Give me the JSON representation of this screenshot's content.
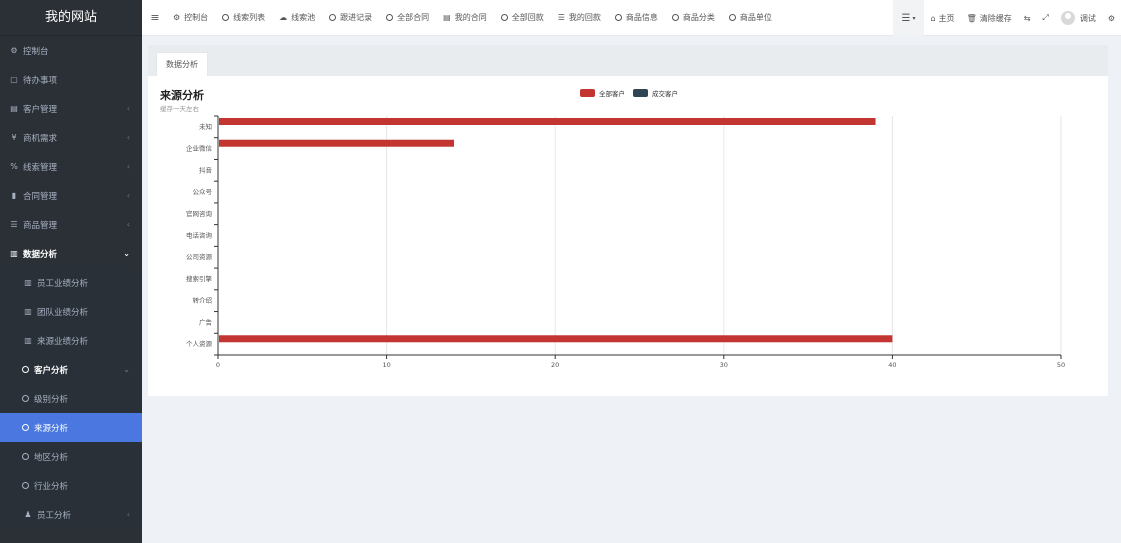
{
  "app": {
    "title": "我的网站"
  },
  "sidebar": {
    "items": [
      {
        "label": "控制台",
        "icon": "dashboard-icon",
        "glyph": "⚙",
        "type": "top"
      },
      {
        "label": "待办事项",
        "icon": "calendar-icon",
        "glyph": "▢",
        "type": "top"
      },
      {
        "label": "客户管理",
        "icon": "id-card-icon",
        "glyph": "▤",
        "type": "top",
        "arrow": "‹"
      },
      {
        "label": "商机需求",
        "icon": "yen-icon",
        "glyph": "¥",
        "type": "top",
        "arrow": "‹"
      },
      {
        "label": "线索管理",
        "icon": "link-icon",
        "glyph": "%",
        "type": "top",
        "arrow": "‹"
      },
      {
        "label": "合同管理",
        "icon": "bookmark-icon",
        "glyph": "▮",
        "type": "top",
        "arrow": "‹"
      },
      {
        "label": "商品管理",
        "icon": "list-icon",
        "glyph": "☰",
        "type": "top",
        "arrow": "‹"
      },
      {
        "label": "数据分析",
        "icon": "bar-chart-icon",
        "glyph": "▥",
        "type": "open",
        "arrow": "⌄"
      },
      {
        "label": "员工业绩分析",
        "icon": "bar-chart-icon",
        "glyph": "▥",
        "type": "sub"
      },
      {
        "label": "团队业绩分析",
        "icon": "bar-chart-icon",
        "glyph": "▥",
        "type": "sub"
      },
      {
        "label": "来源业绩分析",
        "icon": "bar-chart-icon",
        "glyph": "▥",
        "type": "sub"
      },
      {
        "label": "客户分析",
        "icon": "circle-icon",
        "glyph": "",
        "type": "subhead",
        "arrow": "⌄"
      },
      {
        "label": "级别分析",
        "icon": "circle-icon",
        "glyph": "",
        "type": "sub2"
      },
      {
        "label": "来源分析",
        "icon": "circle-icon",
        "glyph": "",
        "type": "active"
      },
      {
        "label": "地区分析",
        "icon": "circle-icon",
        "glyph": "",
        "type": "sub2"
      },
      {
        "label": "行业分析",
        "icon": "circle-icon",
        "glyph": "",
        "type": "sub2"
      },
      {
        "label": "员工分析",
        "icon": "user-icon",
        "glyph": "♟",
        "type": "sub",
        "arrow": "‹"
      }
    ]
  },
  "topbar": {
    "tabs": [
      {
        "label": "控制台",
        "icon": "dashboard-icon",
        "glyph": "⚙"
      },
      {
        "label": "线索列表",
        "icon": "circle-icon",
        "glyph": ""
      },
      {
        "label": "线索池",
        "icon": "cloud-icon",
        "glyph": "☁"
      },
      {
        "label": "跟进记录",
        "icon": "circle-icon",
        "glyph": ""
      },
      {
        "label": "全部合同",
        "icon": "circle-icon",
        "glyph": ""
      },
      {
        "label": "我的合同",
        "icon": "table-icon",
        "glyph": "▤"
      },
      {
        "label": "全部回款",
        "icon": "circle-icon",
        "glyph": ""
      },
      {
        "label": "我的回款",
        "icon": "list-icon",
        "glyph": "☰"
      },
      {
        "label": "商品信息",
        "icon": "circle-icon",
        "glyph": ""
      },
      {
        "label": "商品分类",
        "icon": "circle-icon",
        "glyph": ""
      },
      {
        "label": "商品单位",
        "icon": "circle-icon",
        "glyph": ""
      }
    ],
    "right": {
      "home": "主页",
      "clear_cache": "清除缓存",
      "user": "调试"
    }
  },
  "content": {
    "tab_label": "数据分析",
    "chart_title": "来源分析",
    "chart_subtitle": "缓存一天左右"
  },
  "colors": {
    "series_all": "#c23531",
    "series_deal": "#2f4554",
    "accent": "#4a78e0"
  },
  "chart_data": {
    "type": "bar",
    "orientation": "horizontal",
    "title": "来源分析",
    "subtitle": "缓存一天左右",
    "categories": [
      "未知",
      "企业微信",
      "抖音",
      "公众号",
      "官网咨询",
      "电话咨询",
      "公司资源",
      "搜索引擎",
      "转介绍",
      "广告",
      "个人资源"
    ],
    "series": [
      {
        "name": "全部客户",
        "values": [
          39,
          14,
          0,
          0,
          0,
          0,
          0,
          0,
          0,
          0,
          40
        ]
      },
      {
        "name": "成交客户",
        "values": [
          0,
          0,
          0,
          0,
          0,
          0,
          0,
          0,
          0,
          0,
          0
        ]
      }
    ],
    "xlim": [
      0,
      50
    ],
    "xticks": [
      0,
      10,
      20,
      30,
      40,
      50
    ],
    "grid": true,
    "legend": "top-center"
  }
}
